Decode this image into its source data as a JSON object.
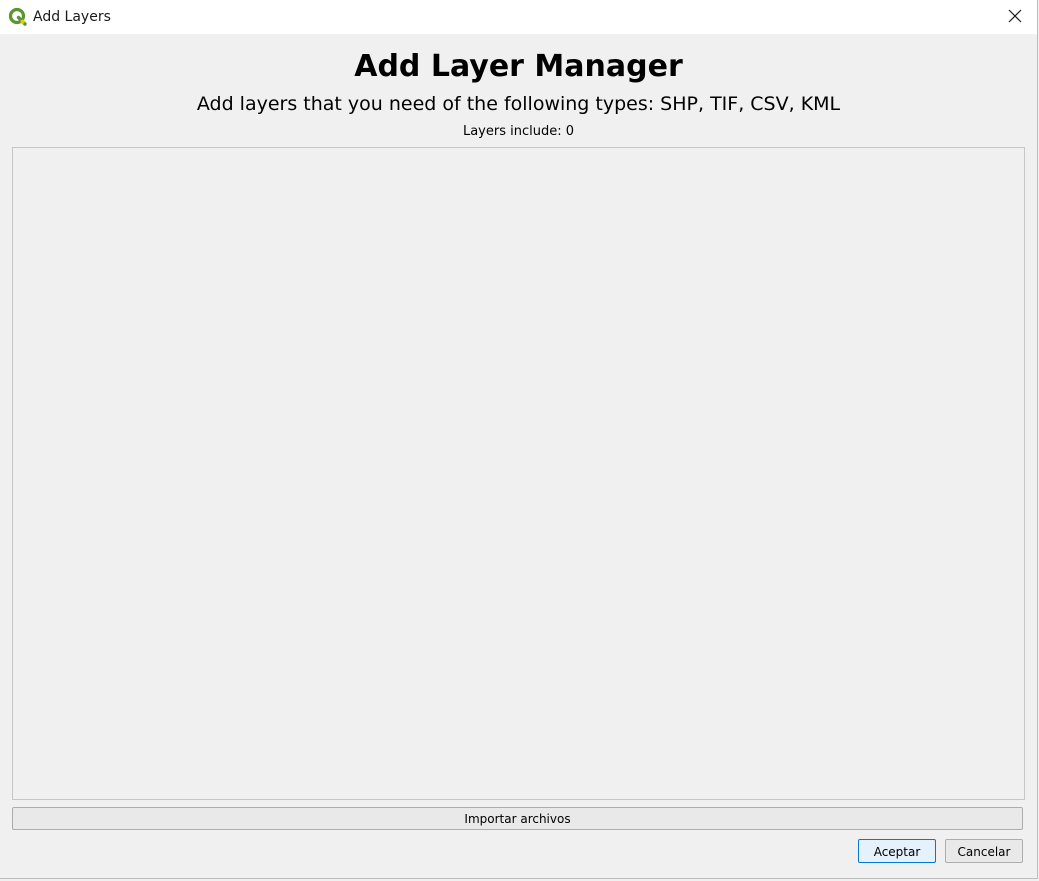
{
  "window": {
    "title": "Add Layers",
    "app_icon": "qgis-logo-icon",
    "close_icon": "close-icon"
  },
  "header": {
    "title": "Add Layer Manager",
    "subtitle": "Add layers that you need of the following types: SHP, TIF, CSV, KML",
    "layer_count": "Layers include: 0"
  },
  "layer_list": {
    "items": []
  },
  "actions": {
    "import_label": "Importar archivos",
    "accept_label": "Aceptar",
    "cancel_label": "Cancelar"
  },
  "colors": {
    "window_bg": "#f0f0f0",
    "titlebar_bg": "#ffffff",
    "qgis_green": "#589632",
    "qgis_yellow": "#eec900",
    "focus_border": "#0078d7"
  }
}
